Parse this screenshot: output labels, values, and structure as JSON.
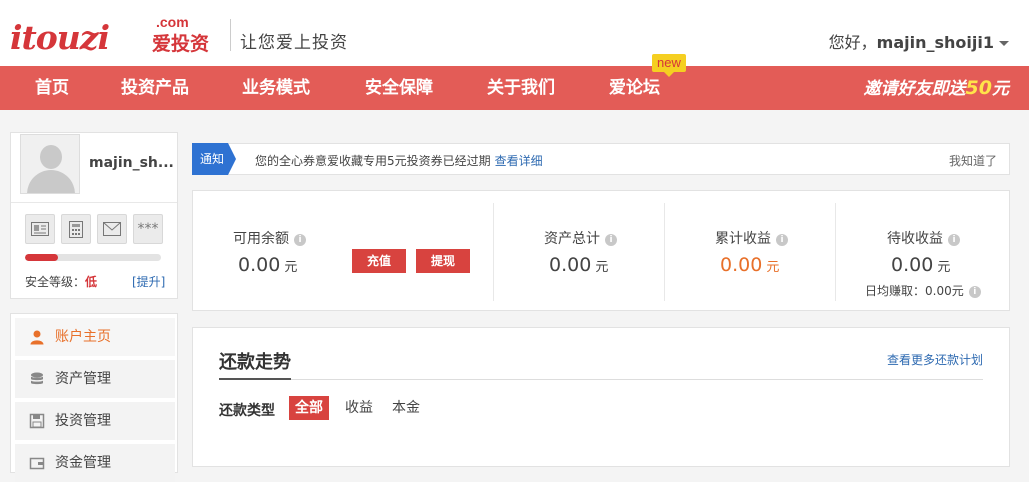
{
  "header": {
    "logo_text": "itouzi",
    "logo_domain": ".com",
    "logo_cn": "爱投资",
    "slogan": "让您爱上投资",
    "greeting_prefix": "您好，",
    "username": "majin_shoiji1"
  },
  "nav": {
    "items": [
      {
        "label": "首页"
      },
      {
        "label": "投资产品"
      },
      {
        "label": "业务模式"
      },
      {
        "label": "安全保障"
      },
      {
        "label": "关于我们"
      },
      {
        "label": "爱论坛",
        "badge": "new"
      }
    ],
    "invite_text": "邀请好友即送",
    "invite_amount": "50",
    "invite_unit": "元",
    "bg_color": "#e35c57"
  },
  "profile": {
    "username": "majin_sh...",
    "security_label": "安全等级：",
    "security_level": "低",
    "security_progress_fraction": 0.24,
    "upgrade_link": "[提升]",
    "verify_icons": [
      "id-card-icon",
      "calculator-icon",
      "email-icon",
      "password-icon"
    ],
    "password_icon_text": "***"
  },
  "menu": {
    "items": [
      {
        "label": "账户主页",
        "icon": "user-icon",
        "active": true
      },
      {
        "label": "资产管理",
        "icon": "coins-icon",
        "active": false
      },
      {
        "label": "投资管理",
        "icon": "save-icon",
        "active": false
      },
      {
        "label": "资金管理",
        "icon": "wallet-icon",
        "active": false
      }
    ]
  },
  "notice": {
    "tag": "通知",
    "text": "您的全心券意爱收藏专用5元投资券已经过期",
    "link": "查看详细",
    "dismiss": "我知道了"
  },
  "summary": {
    "available": {
      "label": "可用余额",
      "value": "0.00",
      "unit": "元"
    },
    "recharge_button": "充值",
    "withdraw_button": "提现",
    "total_assets": {
      "label": "资产总计",
      "value": "0.00",
      "unit": "元"
    },
    "total_income": {
      "label": "累计收益",
      "value": "0.00",
      "unit": "元"
    },
    "pending_income": {
      "label": "待收收益",
      "value": "0.00",
      "unit": "元"
    },
    "daily_earn": "日均赚取：0.00元",
    "info_glyph": "i"
  },
  "repayment": {
    "title": "还款走势",
    "more_link": "查看更多还款计划",
    "type_label": "还款类型",
    "types": [
      "全部",
      "收益",
      "本金"
    ]
  }
}
